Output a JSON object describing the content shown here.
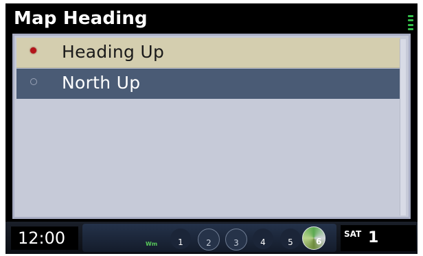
{
  "header": {
    "title": "Map Heading",
    "status_icon": "signal-bars-icon"
  },
  "menu": {
    "items": [
      {
        "label": "Heading Up",
        "selected": true,
        "highlighted": true
      },
      {
        "label": "North Up",
        "selected": false,
        "highlighted": false
      }
    ]
  },
  "status_bar": {
    "clock": "12:00",
    "preset_icon_label": "Wm",
    "presets": [
      "1",
      "2",
      "3",
      "4",
      "5",
      "6"
    ],
    "band_label": "SAT",
    "channel": "1"
  },
  "colors": {
    "highlight": "#d4ceaf",
    "row_dark": "#4a5b75",
    "panel": "#c6cad8",
    "radio_selected": "#b3141a"
  }
}
